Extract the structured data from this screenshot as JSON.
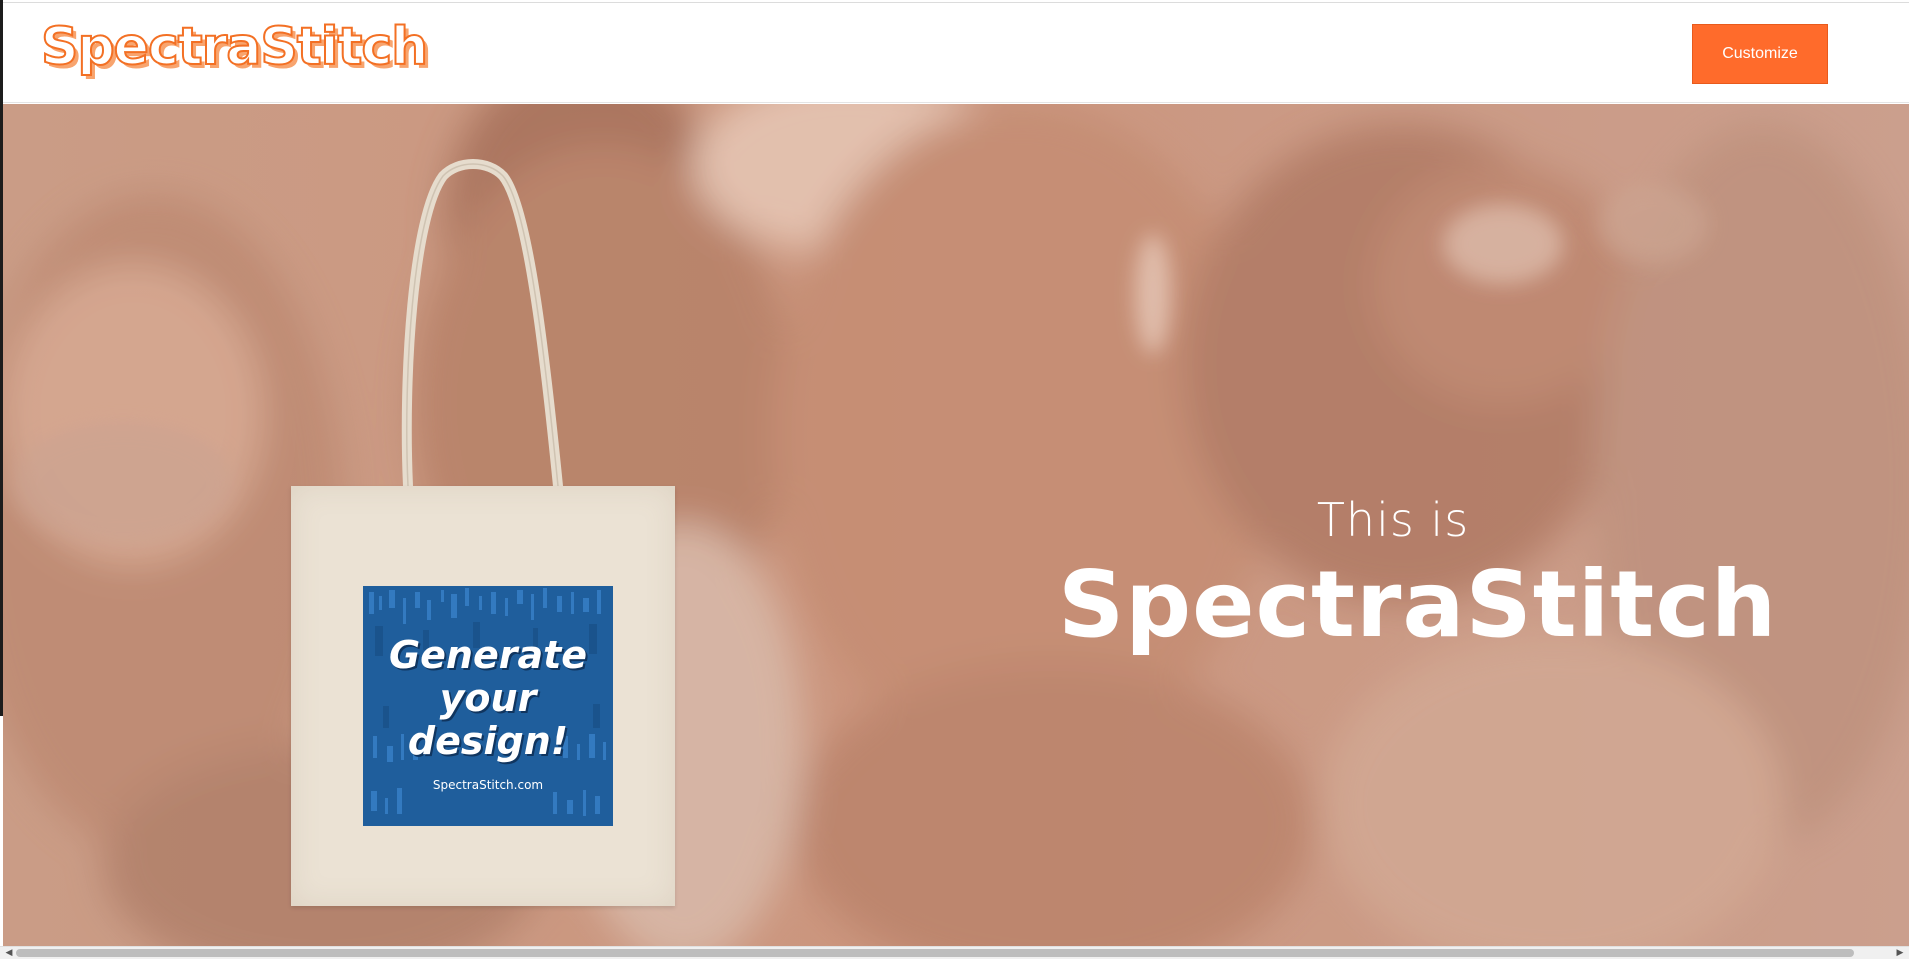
{
  "header": {
    "brand": "SpectraStitch",
    "customize_label": "Customize"
  },
  "hero": {
    "kicker": "This is",
    "title": "SpectraStitch"
  },
  "product": {
    "print_line_1": "Generate",
    "print_line_2": "your",
    "print_line_3": "design!",
    "print_caption": "SpectraStitch.com"
  },
  "icons": {
    "scroll_left": "triangle-left-icon",
    "scroll_right": "triangle-right-icon"
  },
  "colors": {
    "accent": "#ff6b2b",
    "logo_stroke": "#f37024",
    "hero_overlay": "#c89882",
    "print_blue": "#1f5e9c"
  }
}
